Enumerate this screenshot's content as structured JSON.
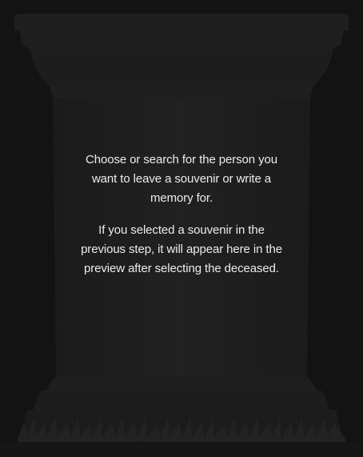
{
  "preview": {
    "paragraph_1": "Choose or search for the person you want to leave a souvenir or write a memory for.",
    "paragraph_2": "If you selected a souvenir in the previous step, it will appear here in the preview after selecting the deceased."
  },
  "colors": {
    "background": "#131313",
    "pillar": "#1e1e1e",
    "text": "#ececec"
  },
  "icons": [
    "pillar-pedestal-icon",
    "grass-icon"
  ]
}
